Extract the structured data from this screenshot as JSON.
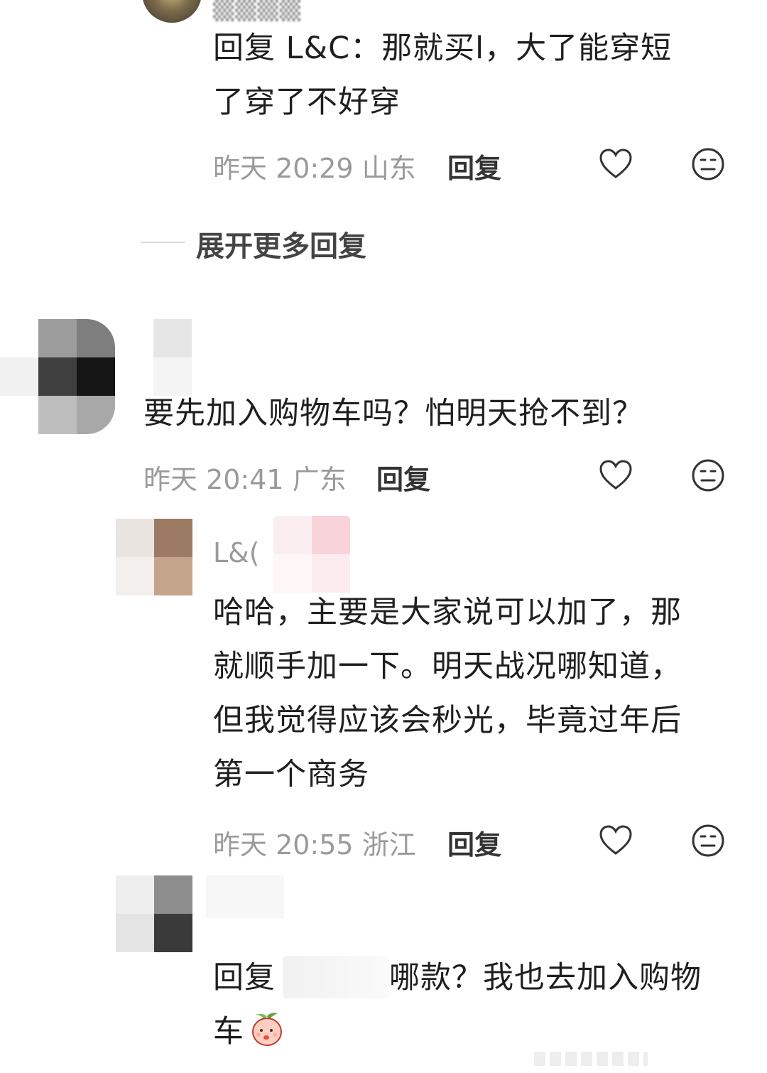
{
  "thread": {
    "top_comment": {
      "text_line1": "回复  L&C：那就买l，大了能穿短",
      "text_line2": "了穿了不好穿",
      "time": "昨天 20:29",
      "region": "山东",
      "reply_label": "回复"
    },
    "expand_more": "展开更多回复",
    "comment2": {
      "text": "要先加入购物车吗？怕明天抢不到？",
      "time": "昨天 20:41",
      "region": "广东",
      "reply_label": "回复"
    },
    "reply1": {
      "username": "L&(",
      "lines": [
        "哈哈，主要是大家说可以加了，那",
        "就顺手加一下。明天战况哪知道，",
        "但我觉得应该会秒光，毕竟过年后",
        "第一个商务"
      ],
      "time": "昨天 20:55",
      "region": "浙江",
      "reply_label": "回复"
    },
    "reply2": {
      "prefix": "回复",
      "text": "哪款？我也去加入购物",
      "line2": "车"
    }
  },
  "colors": {
    "text": "#1f1f1f",
    "meta": "#9a9a9a",
    "icon": "#333333"
  },
  "icons": {
    "like": "heart-outline-icon",
    "dislike": "meh-face-icon",
    "emoji": "peach-emoji-icon"
  }
}
